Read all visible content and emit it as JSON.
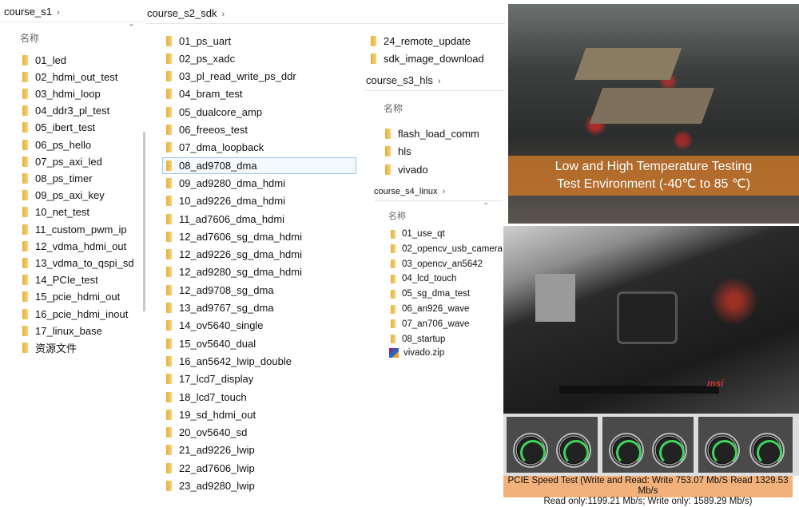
{
  "panels": {
    "s1": {
      "breadcrumb": "course_s1",
      "header": "名称",
      "items": [
        "01_led",
        "02_hdmi_out_test",
        "03_hdmi_loop",
        "04_ddr3_pl_test",
        "05_ibert_test",
        "06_ps_hello",
        "07_ps_axi_led",
        "08_ps_timer",
        "09_ps_axi_key",
        "10_net_test",
        "11_custom_pwm_ip",
        "12_vdma_hdmi_out",
        "13_vdma_to_qspi_sd",
        "14_PCIe_test",
        "15_pcie_hdmi_out",
        "16_pcie_hdmi_inout",
        "17_linux_base",
        "资源文件"
      ]
    },
    "s2": {
      "breadcrumb": "course_s2_sdk",
      "items": [
        "01_ps_uart",
        "02_ps_xadc",
        "03_pl_read_write_ps_ddr",
        "04_bram_test",
        "05_dualcore_amp",
        "06_freeos_test",
        "07_dma_loopback",
        "08_ad9708_dma",
        "09_ad9280_dma_hdmi",
        "10_ad9226_dma_hdmi",
        "11_ad7606_dma_hdmi",
        "12_ad7606_sg_dma_hdmi",
        "12_ad9226_sg_dma_hdmi",
        "12_ad9280_sg_dma_hdmi",
        "12_ad9708_sg_dma",
        "13_ad9767_sg_dma",
        "14_ov5640_single",
        "15_ov5640_dual",
        "16_an5642_lwip_double",
        "17_lcd7_display",
        "18_lcd7_touch",
        "19_sd_hdmi_out",
        "20_ov5640_sd",
        "21_ad9226_lwip",
        "22_ad7606_lwip",
        "23_ad9280_lwip"
      ],
      "items_col2": [
        "24_remote_update",
        "sdk_image_download"
      ],
      "selected": "08_ad9708_dma"
    },
    "s3": {
      "breadcrumb": "course_s3_hls",
      "header": "名称",
      "items": [
        "flash_load_comm",
        "hls",
        "vivado"
      ]
    },
    "s4": {
      "breadcrumb": "course_s4_linux",
      "header": "名称",
      "items": [
        "01_use_qt",
        "02_opencv_usb_camera",
        "03_opencv_an5642",
        "04_lcd_touch",
        "05_sg_dma_test",
        "06_an926_wave",
        "07_an706_wave",
        "08_startup"
      ],
      "zip": "vivado.zip"
    }
  },
  "photos": {
    "temp_caption_1": "Low and High Temperature Testing",
    "temp_caption_2": "Test Environment (-40℃ to 85 ℃)",
    "board_logo": "msi",
    "speed_1": "PCIE Speed Test (Write and Read: Write 753.07 Mb/S Read 1329.53 Mb/s",
    "speed_2": "Read only:1199.21 Mb/s; Write only: 1589.29 Mb/s)"
  },
  "colors": {
    "folder": "#f0c24f",
    "selection": "#9cc6ea",
    "caption_bg": "#f2b07a"
  }
}
